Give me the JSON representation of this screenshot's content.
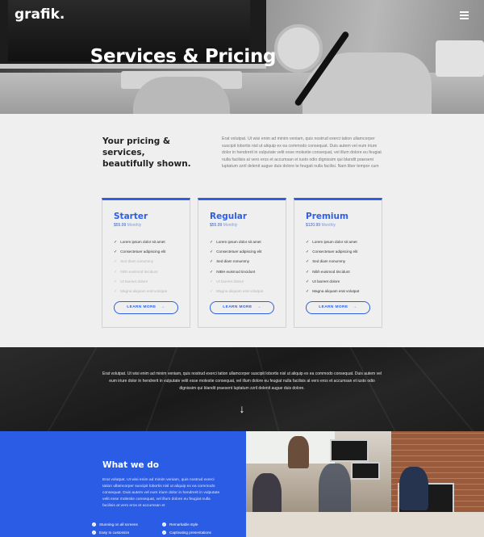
{
  "header": {
    "logo": "grafik.",
    "menu_icon": "hamburger-menu-icon"
  },
  "hero": {
    "title": "Services & Pricing"
  },
  "intro": {
    "heading_line1": "Your pricing & services,",
    "heading_line2": "beautifully shown.",
    "text": "Erat volutpat. Ut wisi enim ad minim veniam, quis nostrud exerci tation ullamcorper suscipit lobortis nisl ut aliquip ex ea commodo consequat. Duis autem vel eum iriure dolor in hendrerit in vulputate velit esse molestie consequat, vel illum dolore eu feugiat nulla facilisis at vero eros et accumsan et iusto odio dignissim qui blandit praesent luptatum zzril delenit augue duis dolore te feugait nulla facilisi. Nam liber tempor cum"
  },
  "pricing": {
    "button_label": "LEARN MORE",
    "button_arrow": "→",
    "check": "✓",
    "plans": [
      {
        "name": "Starter",
        "price": "$55.99",
        "unit": "Monthly",
        "features": [
          {
            "label": "Lorem ipsum dolor sit amet",
            "included": true
          },
          {
            "label": "Consectetuer adipiscing elit",
            "included": true
          },
          {
            "label": "Sed diam nonummy",
            "included": false
          },
          {
            "label": "Nibh euismod tincidunt",
            "included": false
          },
          {
            "label": "Ut laoreet dolore",
            "included": false
          },
          {
            "label": "Magna aliquam erat volutpat",
            "included": false
          }
        ]
      },
      {
        "name": "Regular",
        "price": "$55.99",
        "unit": "Monthly",
        "features": [
          {
            "label": "Lorem ipsum dolor sit amet",
            "included": true
          },
          {
            "label": "Consectetuer adipiscing elit",
            "included": true
          },
          {
            "label": "Sed diam nonummy",
            "included": true
          },
          {
            "label": "NIBH euismod tincidunt",
            "included": true
          },
          {
            "label": "Ut laoreet dolore",
            "included": false
          },
          {
            "label": "Magna aliquam erat volutpat",
            "included": false
          }
        ]
      },
      {
        "name": "Premium",
        "price": "$120.99",
        "unit": "Monthly",
        "features": [
          {
            "label": "Lorem ipsum dolor sit amet",
            "included": true
          },
          {
            "label": "Consectetuer adipiscing elit",
            "included": true
          },
          {
            "label": "Sed diam nonummy",
            "included": true
          },
          {
            "label": "Nibh euismod tincidunt",
            "included": true
          },
          {
            "label": "Ut laoreet dolore",
            "included": true
          },
          {
            "label": "Magna aliquam erat volutpat",
            "included": true
          }
        ]
      }
    ]
  },
  "band": {
    "text": "Erat volutpat. Ut wisi enim ad minim veniam, quis nostrud exerci tation ullamcorper suscipit lobortis nisl ut aliquip ex ea commodo consequat. Duis autem vel eum iriure dolor in hendrerit in vulputate velit esse molestie consequat, vel illum dolore eu feugiat nulla facilisis at vero eros et accumsan et iusto odio dignissim qui blandit praesent luptatum zzril delenit augue duis dolore.",
    "arrow": "↓"
  },
  "what_we_do": {
    "title": "What we do",
    "text": "Erat volutpat. Ut wisi enim ad minim veniam, quis nostrud exerci tation ullamcorper suscipit lobortis nisl ut aliquip ex ea commodo consequat. Duis autem vel eum iriure dolor in hendrerit in vulputate velit esse molestie consequat, vel illum dolore eu feugiat nulla facilisis at vero eros et accumsan et",
    "features": [
      "Stunning on all screens",
      "Remarkable style",
      "Easy to customize",
      "Captivating presentations"
    ]
  },
  "colors": {
    "accent": "#2f5fe0",
    "blue_section": "#2b5ce6"
  }
}
